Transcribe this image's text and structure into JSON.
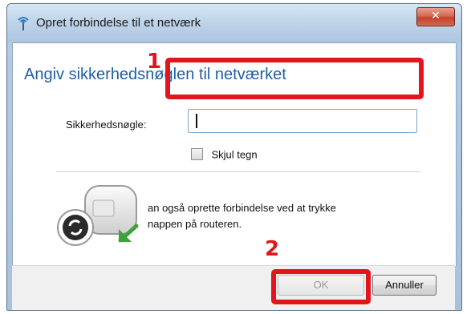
{
  "window": {
    "title": "Opret forbindelse til et netværk",
    "close_glyph": "✕"
  },
  "dialog": {
    "heading": "Angiv sikkerhedsnøglen til netværket",
    "security_key_label": "Sikkerhedsnøgle:",
    "security_key_value": "",
    "hide_characters_label": "Skjul tegn",
    "hide_characters_checked": false,
    "router_info_line1": "an også oprette forbindelse ved at trykke",
    "router_info_line2": "nappen på routeren."
  },
  "buttons": {
    "ok_label": "OK",
    "ok_enabled": false,
    "cancel_label": "Annuller"
  },
  "annotations": {
    "marker_1": "1",
    "marker_2": "2",
    "highlight_color": "#e4141c"
  },
  "icons": {
    "title_icon": "network-icon",
    "router_icon": "router-wps-icon"
  }
}
